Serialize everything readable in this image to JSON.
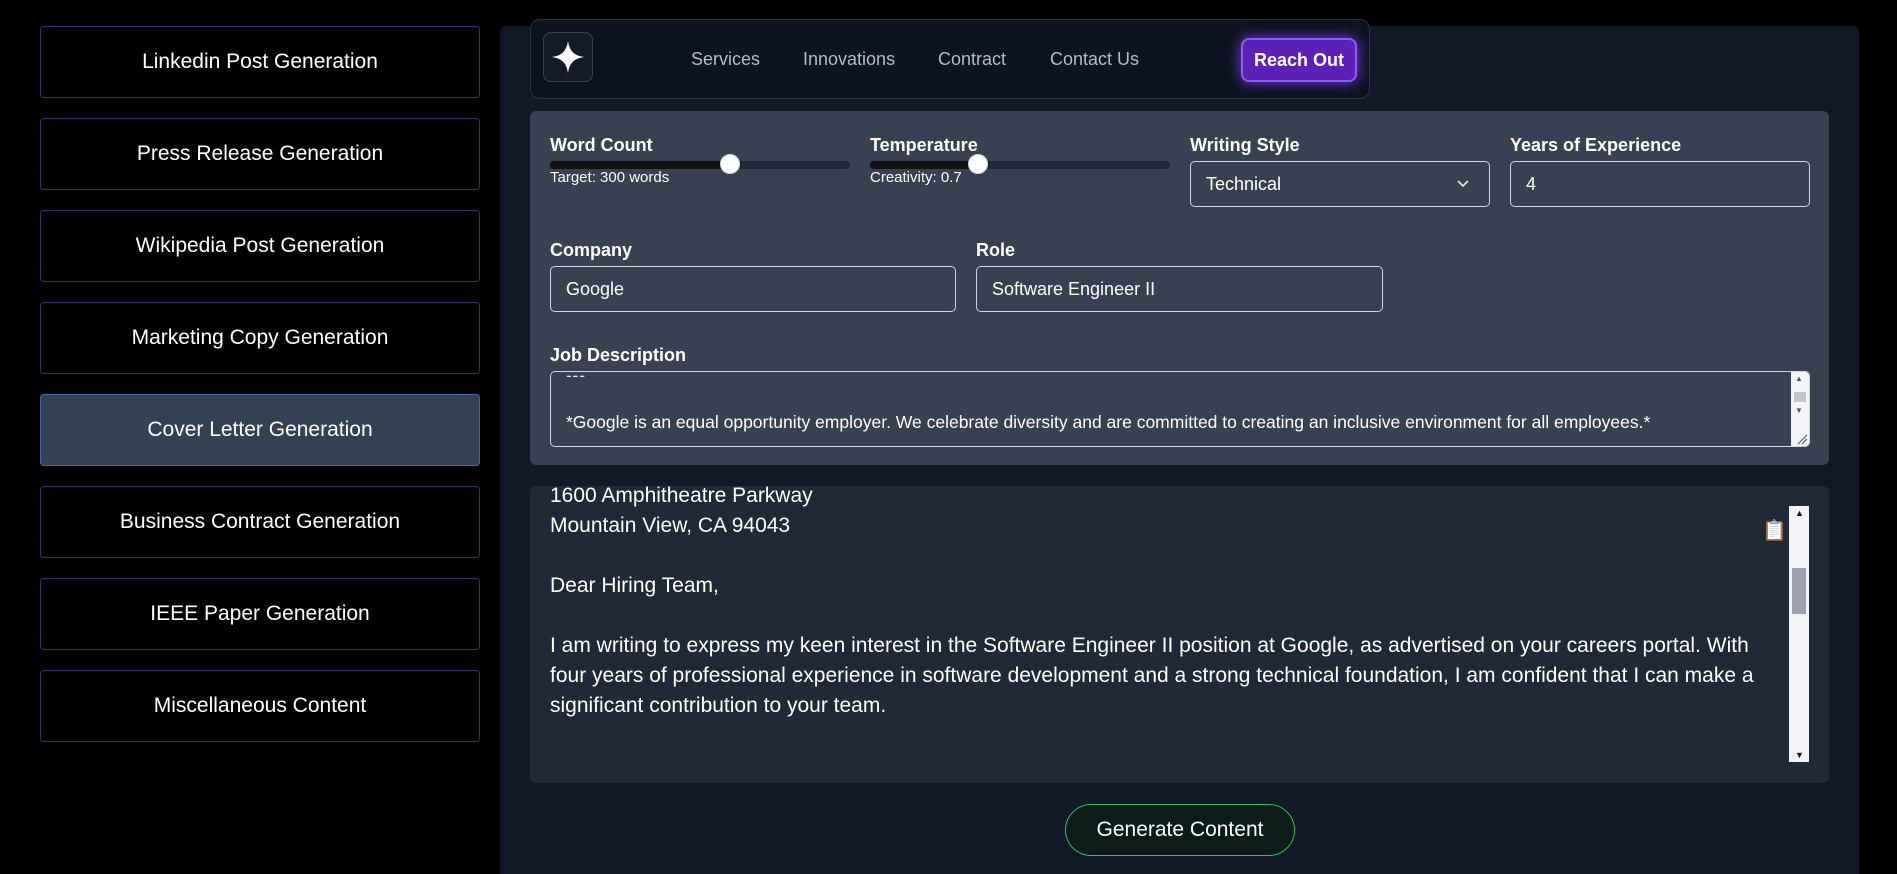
{
  "sidebar": {
    "items": [
      {
        "label": "Linkedin Post Generation"
      },
      {
        "label": "Press Release Generation"
      },
      {
        "label": "Wikipedia Post Generation"
      },
      {
        "label": "Marketing Copy Generation"
      },
      {
        "label": "Cover Letter Generation",
        "active": true
      },
      {
        "label": "Business Contract Generation"
      },
      {
        "label": "IEEE Paper Generation"
      },
      {
        "label": "Miscellaneous Content"
      }
    ]
  },
  "navbar": {
    "links": [
      "Services",
      "Innovations",
      "Contract",
      "Contact Us"
    ],
    "cta": "Reach Out",
    "logo_icon": "sparkle-icon"
  },
  "form": {
    "word_count": {
      "label": "Word Count",
      "value_text": "Target: 300 words",
      "fraction": 0.6
    },
    "temperature": {
      "label": "Temperature",
      "value_text": "Creativity: 0.7",
      "fraction": 0.36
    },
    "writing_style": {
      "label": "Writing Style",
      "value": "Technical"
    },
    "years_experience": {
      "label": "Years of Experience",
      "value": "4"
    },
    "company": {
      "label": "Company",
      "value": "Google"
    },
    "role": {
      "label": "Role",
      "value": "Software Engineer II"
    },
    "job_description": {
      "label": "Job Description",
      "partial_line": "---",
      "text": "*Google is an equal opportunity employer. We celebrate diversity and are committed to creating an inclusive environment for all employees.*"
    }
  },
  "output": {
    "address_line1": "1600 Amphitheatre Parkway",
    "address_line2": "Mountain View, CA 94043",
    "salutation": "Dear Hiring Team,",
    "paragraph1": "I am writing to express my keen interest in the Software Engineer II position at Google, as advertised on your careers portal. With four years of professional experience in software development and a strong technical foundation, I am confident that I can make a significant contribution to your team.",
    "copy_icon": "clipboard-icon"
  },
  "generate_button": "Generate Content",
  "colors": {
    "accent_purple": "#5b21b6",
    "generate_border": "#22c55e",
    "active_item": "#334155"
  }
}
